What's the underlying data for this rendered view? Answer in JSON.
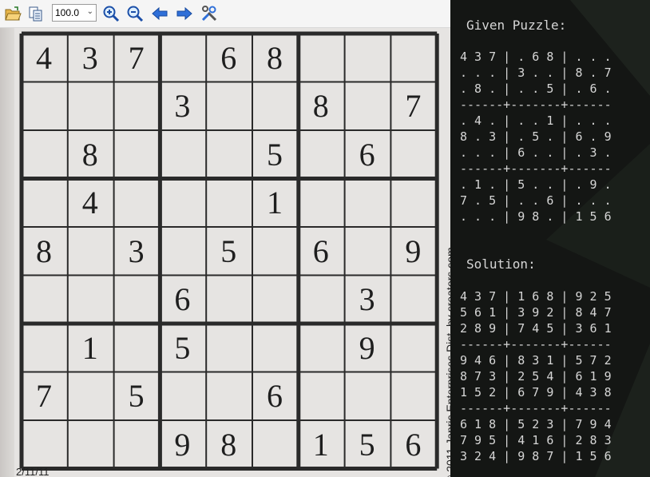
{
  "toolbar": {
    "zoom_value": "100.0",
    "icons": [
      "open-folder-icon",
      "copy-icon",
      "zoom-in-icon",
      "zoom-out-icon",
      "back-arrow-icon",
      "forward-arrow-icon",
      "tools-icon"
    ]
  },
  "photo": {
    "copyright": "© 2011 Janric Enterprises Dist. by creators.com",
    "date": "2/11/11",
    "grid": [
      [
        "4",
        "3",
        "7",
        "",
        "6",
        "8",
        "",
        "",
        ""
      ],
      [
        "",
        "",
        "",
        "3",
        "",
        "",
        "8",
        "",
        "7"
      ],
      [
        "",
        "8",
        "",
        "",
        "",
        "5",
        "",
        "6",
        ""
      ],
      [
        "",
        "4",
        "",
        "",
        "",
        "1",
        "",
        "",
        ""
      ],
      [
        "8",
        "",
        "3",
        "",
        "5",
        "",
        "6",
        "",
        "9"
      ],
      [
        "",
        "",
        "",
        "6",
        "",
        "",
        "",
        "3",
        ""
      ],
      [
        "",
        "1",
        "",
        "5",
        "",
        "",
        "",
        "9",
        ""
      ],
      [
        "7",
        "",
        "5",
        "",
        "",
        "6",
        "",
        "",
        ""
      ],
      [
        "",
        "",
        "",
        "9",
        "8",
        "",
        "1",
        "5",
        "6"
      ]
    ]
  },
  "terminal": {
    "given_title": "Given Puzzle:",
    "given_lines": [
      "4 3 7 | . 6 8 | . . .",
      ". . . | 3 . . | 8 . 7",
      ". 8 . | . . 5 | . 6 .",
      "------+-------+------",
      ". 4 . | . . 1 | . . .",
      "8 . 3 | . 5 . | 6 . 9",
      ". . . | 6 . . | . 3 .",
      "------+-------+------",
      ". 1 . | 5 . . | . 9 .",
      "7 . 5 | . . 6 | . . .",
      ". . . | 9 8 . | 1 5 6"
    ],
    "solution_title": "Solution:",
    "solution_lines": [
      "4 3 7 | 1 6 8 | 9 2 5",
      "5 6 1 | 3 9 2 | 8 4 7",
      "2 8 9 | 7 4 5 | 3 6 1",
      "------+-------+------",
      "9 4 6 | 8 3 1 | 5 7 2",
      "8 7 3 | 2 5 4 | 6 1 9",
      "1 5 2 | 6 7 9 | 4 3 8",
      "------+-------+------",
      "6 1 8 | 5 2 3 | 7 9 4",
      "7 9 5 | 4 1 6 | 2 8 3",
      "3 2 4 | 9 8 7 | 1 5 6"
    ]
  }
}
